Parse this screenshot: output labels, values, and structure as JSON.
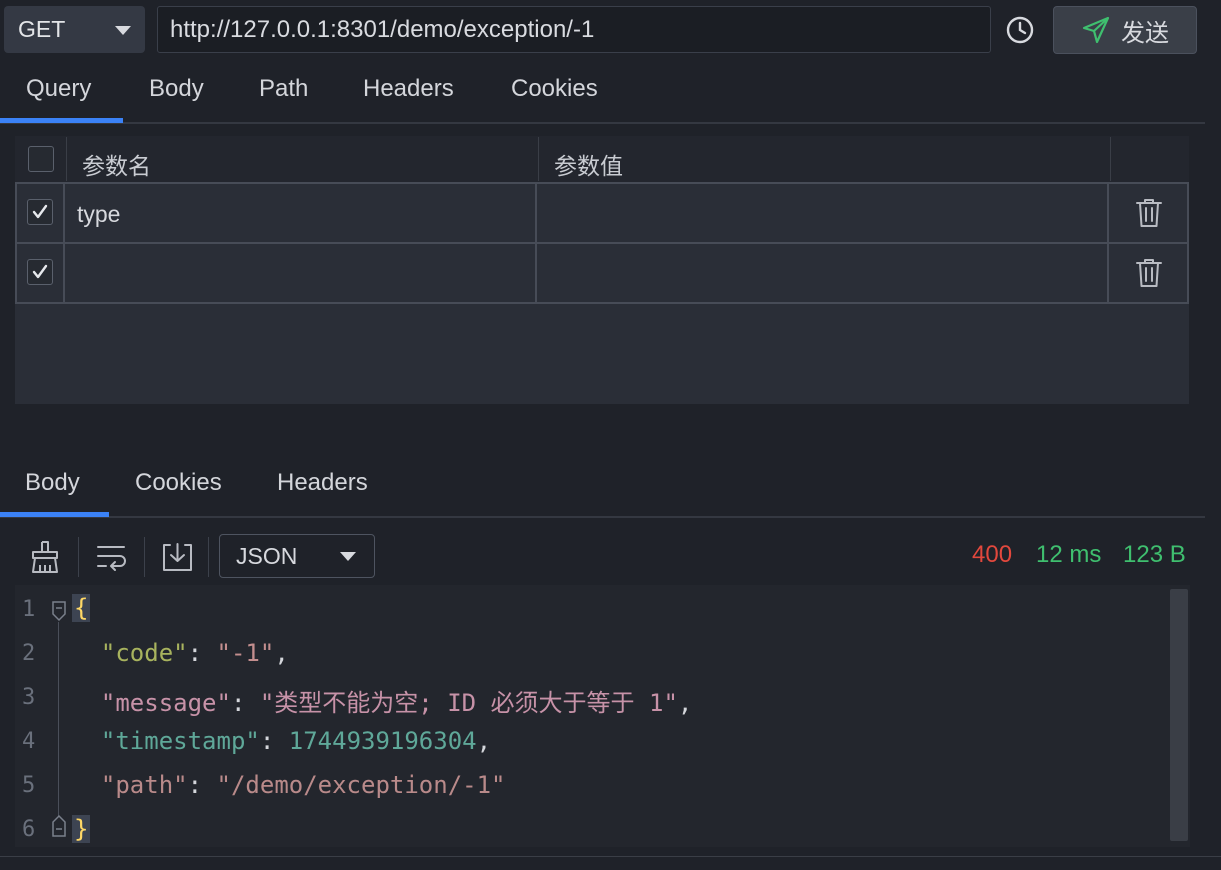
{
  "request": {
    "method": "GET",
    "url": "http://127.0.0.1:8301/demo/exception/-1",
    "send_label": "发送"
  },
  "request_tabs": [
    "Query",
    "Body",
    "Path",
    "Headers",
    "Cookies"
  ],
  "params_table": {
    "headers": {
      "name": "参数名",
      "value": "参数值"
    },
    "rows": [
      {
        "checked": true,
        "name": "type",
        "value": ""
      },
      {
        "checked": true,
        "name": "",
        "value": ""
      }
    ]
  },
  "response_tabs": [
    "Body",
    "Cookies",
    "Headers"
  ],
  "response": {
    "format": "JSON",
    "status": "400",
    "time": "12 ms",
    "size": "123 B",
    "status_color": "#e2483d",
    "ok_color": "#3fbf6f"
  },
  "code": {
    "line_numbers": [
      "1",
      "2",
      "3",
      "4",
      "5",
      "6"
    ],
    "open_brace": "{",
    "close_brace": "}",
    "lines": [
      {
        "key": "\"code\"",
        "sep": ": ",
        "value": "\"-1\"",
        "end": ","
      },
      {
        "key": "\"message\"",
        "sep": ": ",
        "value": "\"类型不能为空; ID 必须大于等于 1\"",
        "end": ","
      },
      {
        "key": "\"timestamp\"",
        "sep": ": ",
        "value": "1744939196304",
        "end": ","
      },
      {
        "key": "\"path\"",
        "sep": ": ",
        "value": "\"/demo/exception/-1\"",
        "end": ""
      }
    ]
  },
  "icons": [
    "chevron-down-icon",
    "clock-icon",
    "send-icon",
    "trash-icon",
    "broom-icon",
    "wrap-icon",
    "download-icon",
    "fold-icon"
  ]
}
